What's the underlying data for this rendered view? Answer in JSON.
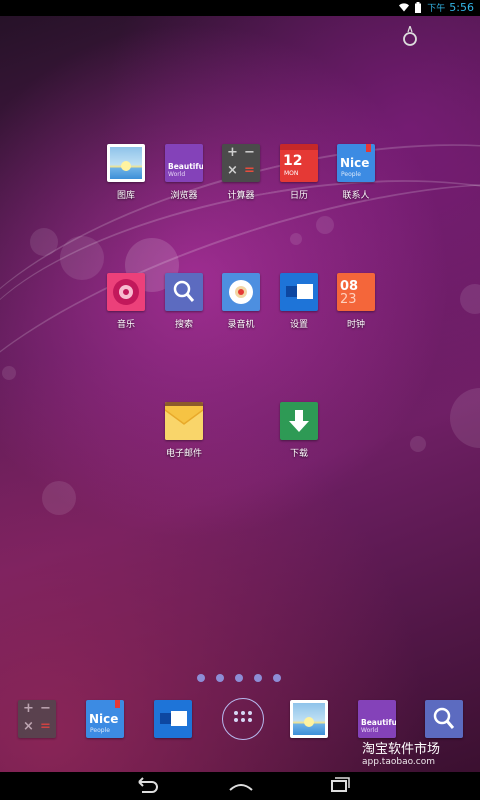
{
  "status_bar": {
    "period": "下午",
    "time": "5:56",
    "icons": [
      "wifi-icon",
      "battery-icon"
    ]
  },
  "apps": [
    {
      "id": "gallery",
      "label": "图库"
    },
    {
      "id": "browser",
      "label": "浏览器",
      "tile_text": "Beautiful",
      "tile_subtext": "World"
    },
    {
      "id": "calculator",
      "label": "计算器"
    },
    {
      "id": "calendar",
      "label": "日历",
      "tile_text": "12",
      "tile_subtext": "MON"
    },
    {
      "id": "contacts",
      "label": "联系人",
      "tile_text": "Nice",
      "tile_subtext": "People"
    },
    {
      "id": "music",
      "label": "音乐"
    },
    {
      "id": "search",
      "label": "搜索"
    },
    {
      "id": "recorder",
      "label": "录音机"
    },
    {
      "id": "settings",
      "label": "设置"
    },
    {
      "id": "clock",
      "label": "时钟",
      "tile_text": "08",
      "tile_subtext": "23"
    },
    {
      "id": "email",
      "label": "电子邮件"
    },
    {
      "id": "download",
      "label": "下载"
    }
  ],
  "page_indicator": {
    "count": 5
  },
  "dock": {
    "items": [
      "calculator",
      "contacts",
      "settings",
      "app-drawer",
      "gallery",
      "browser",
      "search"
    ],
    "contacts_text": "Nice",
    "contacts_subtext": "People",
    "browser_text": "Beautiful",
    "browser_subtext": "World"
  },
  "watermark": {
    "title": "淘宝软件市场",
    "url": "app.taobao.com"
  },
  "nav_bar": [
    "back-button",
    "home-button",
    "recents-button"
  ],
  "colors": {
    "status_accent": "#33b5e5",
    "page_dot": "#8d8ed6"
  }
}
